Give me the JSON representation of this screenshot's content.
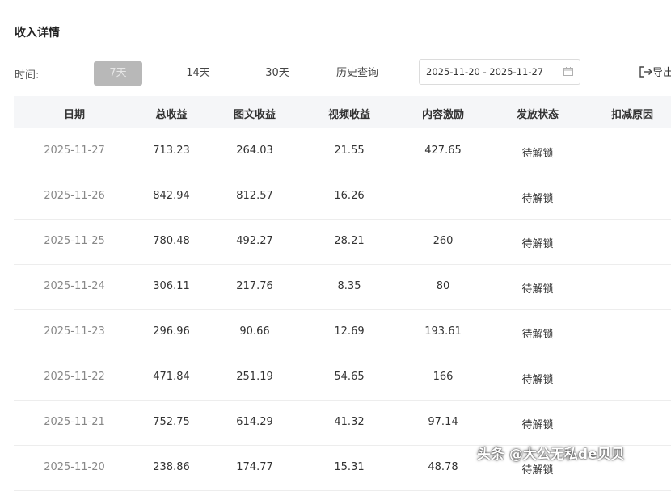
{
  "page": {
    "title": "收入详情"
  },
  "filters": {
    "time_label": "时间:",
    "ranges": [
      "7天",
      "14天",
      "30天",
      "历史查询"
    ],
    "active_range": "7天",
    "date_range_value": "2025-11-20 - 2025-11-27",
    "export_label": "导出"
  },
  "table": {
    "columns": [
      "日期",
      "总收益",
      "图文收益",
      "视频收益",
      "内容激励",
      "发放状态",
      "扣减原因"
    ],
    "rows": [
      [
        "2025-11-27",
        "713.23",
        "264.03",
        "21.55",
        "427.65",
        "待解锁",
        ""
      ],
      [
        "2025-11-26",
        "842.94",
        "812.57",
        "16.26",
        "",
        "待解锁",
        ""
      ],
      [
        "2025-11-25",
        "780.48",
        "492.27",
        "28.21",
        "260",
        "待解锁",
        ""
      ],
      [
        "2025-11-24",
        "306.11",
        "217.76",
        "8.35",
        "80",
        "待解锁",
        ""
      ],
      [
        "2025-11-23",
        "296.96",
        "90.66",
        "12.69",
        "193.61",
        "待解锁",
        ""
      ],
      [
        "2025-11-22",
        "471.84",
        "251.19",
        "54.65",
        "166",
        "待解锁",
        ""
      ],
      [
        "2025-11-21",
        "752.75",
        "614.29",
        "41.32",
        "97.14",
        "待解锁",
        ""
      ],
      [
        "2025-11-20",
        "238.86",
        "174.77",
        "15.31",
        "48.78",
        "待解锁",
        ""
      ]
    ]
  },
  "watermark": {
    "text": "头条 @大公无私de贝贝"
  },
  "icons": {
    "date_picker": "calendar-icon",
    "export": "export-icon"
  },
  "colors": {
    "active_range_bg": "#b8b8b8",
    "header_bg": "#f5f6f8",
    "row_border": "#ededed"
  }
}
